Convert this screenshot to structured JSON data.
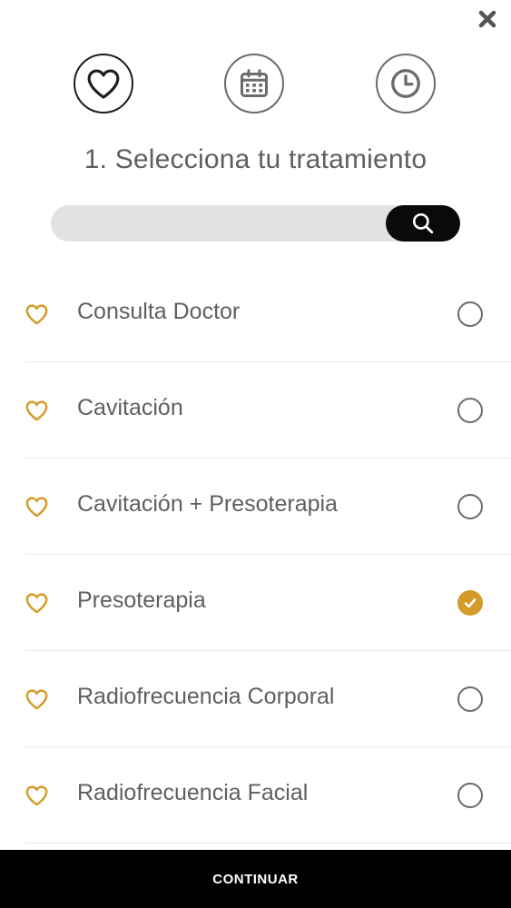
{
  "header": {
    "close_icon": "close-icon",
    "steps": [
      {
        "icon": "heart-icon",
        "state": "active"
      },
      {
        "icon": "calendar-icon",
        "state": "inactive"
      },
      {
        "icon": "clock-icon",
        "state": "inactive"
      }
    ],
    "title": "1. Selecciona tu tratamiento"
  },
  "search": {
    "value": "",
    "placeholder": "",
    "icon": "search-icon"
  },
  "treatments": [
    {
      "label": "Consulta Doctor",
      "selected": false
    },
    {
      "label": "Cavitación",
      "selected": false
    },
    {
      "label": "Cavitación + Presoterapia",
      "selected": false
    },
    {
      "label": "Presoterapia",
      "selected": true
    },
    {
      "label": "Radiofrecuencia Corporal",
      "selected": false
    },
    {
      "label": "Radiofrecuencia Facial",
      "selected": false
    }
  ],
  "footer": {
    "continue_label": "CONTINUAR"
  },
  "colors": {
    "accent": "#d49b28",
    "text": "#5f5f5f",
    "footer_bg": "#000000",
    "search_bg": "#e2e2e2"
  }
}
